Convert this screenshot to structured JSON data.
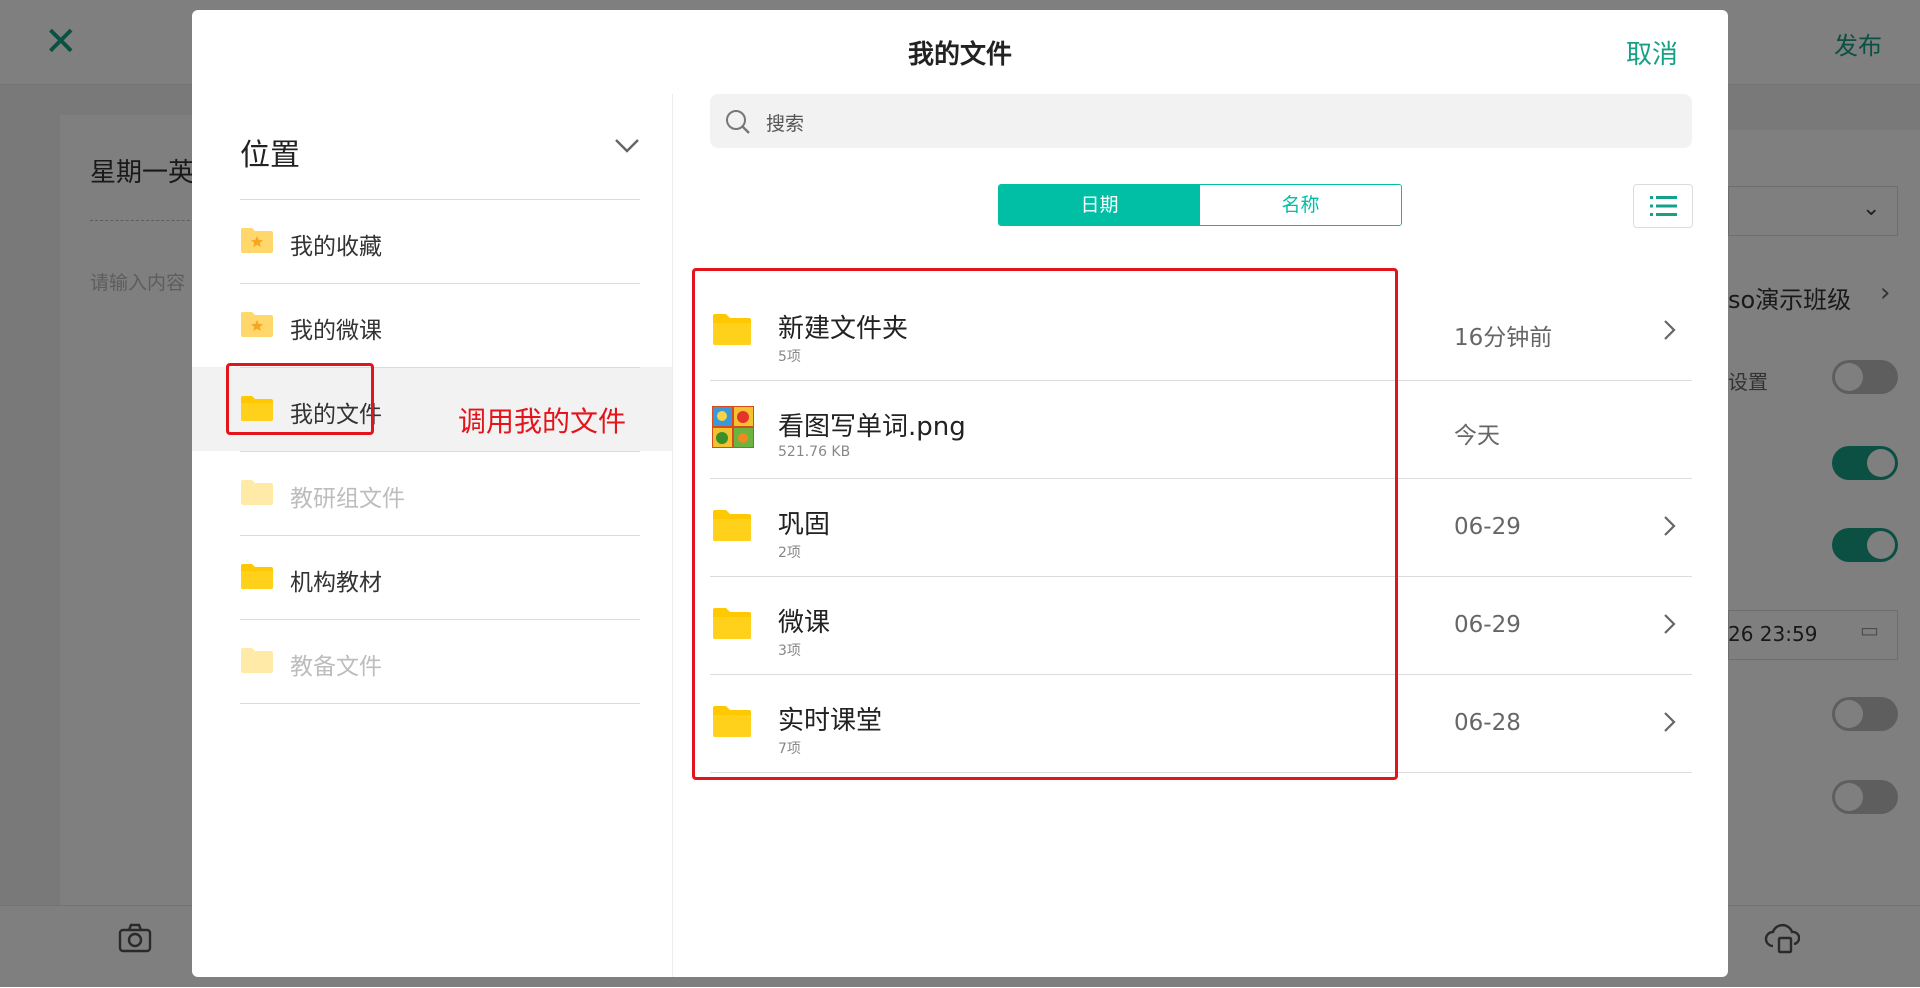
{
  "background": {
    "publish_label": "发布",
    "card_title": "星期一英",
    "card_placeholder": "请输入内容",
    "class_label": "so演示班级",
    "setting_label": "设置",
    "deadline_text": "26 23:59"
  },
  "modal": {
    "title": "我的文件",
    "cancel_label": "取消"
  },
  "location": {
    "title": "位置",
    "items": [
      {
        "label": "我的收藏",
        "icon": "folder-star-icon",
        "state": "normal"
      },
      {
        "label": "我的微课",
        "icon": "folder-star-icon",
        "state": "normal"
      },
      {
        "label": "我的文件",
        "icon": "folder-icon",
        "state": "active"
      },
      {
        "label": "教研组文件",
        "icon": "folder-icon",
        "state": "disabled"
      },
      {
        "label": "机构教材",
        "icon": "folder-icon",
        "state": "normal"
      },
      {
        "label": "教备文件",
        "icon": "folder-icon",
        "state": "disabled"
      }
    ]
  },
  "annotation": "调用我的文件",
  "search": {
    "placeholder": "搜索"
  },
  "sort": {
    "date_label": "日期",
    "name_label": "名称",
    "selected": "日期"
  },
  "files": [
    {
      "name": "新建文件夹",
      "meta": "5项",
      "date": "16分钟前",
      "type": "folder"
    },
    {
      "name": "看图写单词.png",
      "meta": "521.76 KB",
      "date": "今天",
      "type": "image"
    },
    {
      "name": "巩固",
      "meta": "2项",
      "date": "06-29",
      "type": "folder"
    },
    {
      "name": "微课",
      "meta": "3项",
      "date": "06-29",
      "type": "folder"
    },
    {
      "name": "实时课堂",
      "meta": "7项",
      "date": "06-28",
      "type": "folder"
    }
  ],
  "colors": {
    "accent": "#00bfa5",
    "folder": "#ffd11a",
    "highlight": "#e3141b"
  }
}
